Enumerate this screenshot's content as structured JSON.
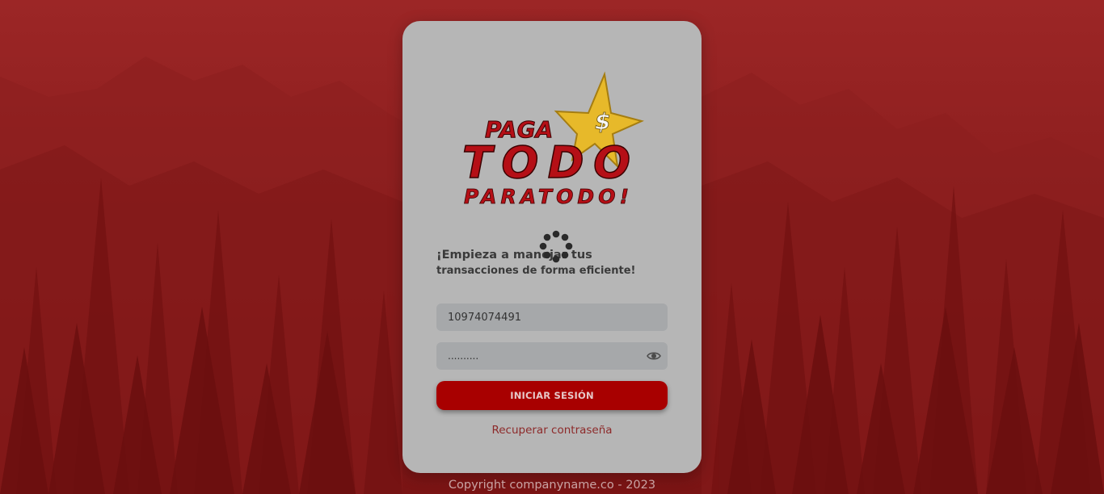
{
  "logo": {
    "line1": "PAGA",
    "line2": "TODO",
    "line3": "PARATODO!",
    "star_symbol": "$",
    "colors": {
      "text": "#b50f16",
      "star": "#e7b92a"
    }
  },
  "headline": {
    "line1": "¡Empieza a manejar tus",
    "line2": "transacciones de forma eficiente!"
  },
  "form": {
    "username_value": "10974074491",
    "password_value": "..........",
    "password_toggle_icon": "eye-icon",
    "login_button_label": "INICIAR SESIÓN",
    "recover_link": "Recuperar contraseña"
  },
  "footer": {
    "copyright": "Copyright companyname.co - 2023"
  },
  "loading_spinner_icon": "loading-spinner-icon",
  "colors": {
    "background": "#8f1f1f",
    "card": "#b6b6b6",
    "button": "#a80000",
    "field": "#a6a8aa"
  }
}
